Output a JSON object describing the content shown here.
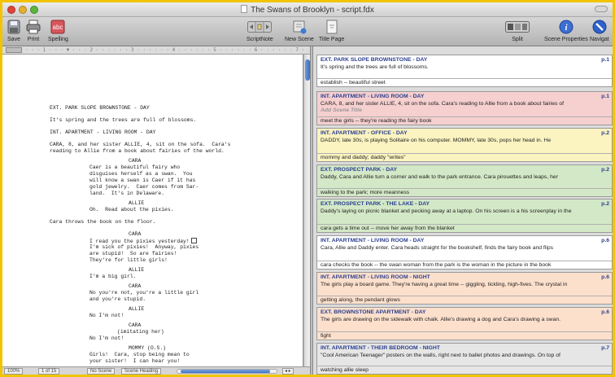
{
  "window": {
    "title": "The Swans of Brooklyn - script.fdx"
  },
  "toolbar": {
    "save": "Save",
    "print": "Print",
    "spelling": "Spelling",
    "scriptnote": "ScriptNote",
    "new_scene": "New Scene",
    "title_page": "Title Page",
    "split": "Split",
    "scene_properties": "Scene Properties",
    "navigator": "Navigat"
  },
  "statusbar": {
    "zoom": "100%",
    "page": "1 of 15",
    "scene_no": "No Scene",
    "element": "Scene Heading"
  },
  "script": {
    "lines": [
      {
        "k": "sh",
        "t": "EXT. PARK SLOPE BROWNSTONE - DAY"
      },
      {
        "k": "ac",
        "t": "It's spring and the trees are full of blossoms."
      },
      {
        "k": "sh",
        "t": "INT. APARTMENT - LIVING ROOM - DAY"
      },
      {
        "k": "ac",
        "t": "CARA, 8, and her sister ALLIE, 4, sit on the sofa.  Cara's"
      },
      {
        "k": "ac",
        "t": "reading to Allie from a book about fairies of the world."
      },
      {
        "k": "ch",
        "t": "CARA"
      },
      {
        "k": "dl",
        "t": "Caer is a beautiful fairy who"
      },
      {
        "k": "dl",
        "t": "disguises herself as a swan.  You"
      },
      {
        "k": "dl",
        "t": "will know a swan is Caer if it has"
      },
      {
        "k": "dl",
        "t": "gold jewelry.  Caer comes from Sar-"
      },
      {
        "k": "dl",
        "t": "land.  It's in Delaware."
      },
      {
        "k": "ch",
        "t": "ALLIE"
      },
      {
        "k": "dl",
        "t": "Oh.  Read about the pixies."
      },
      {
        "k": "ac",
        "t": "Cara throws the book on the floor."
      },
      {
        "k": "ch",
        "t": "CARA"
      },
      {
        "k": "dl",
        "t": "I read you the pixies yesterday!"
      },
      {
        "k": "dl",
        "t": "I'm sick of pixies!  Anyway, pixies"
      },
      {
        "k": "dl",
        "t": "are stupid!  So are fairies!"
      },
      {
        "k": "dl",
        "t": "They're for little girls!"
      },
      {
        "k": "ch",
        "t": "ALLIE"
      },
      {
        "k": "dl",
        "t": "I'm a big girl."
      },
      {
        "k": "ch",
        "t": "CARA"
      },
      {
        "k": "dl",
        "t": "No you're not, you're a little girl"
      },
      {
        "k": "dl",
        "t": "and you're stupid."
      },
      {
        "k": "ch",
        "t": "ALLIE"
      },
      {
        "k": "dl",
        "t": "No I'm not!"
      },
      {
        "k": "ch",
        "t": "CARA"
      },
      {
        "k": "pr",
        "t": "(imitating her)"
      },
      {
        "k": "dl",
        "t": "No I'm not!"
      },
      {
        "k": "ch",
        "t": "MOMMY (O.S.)"
      },
      {
        "k": "dl",
        "t": "Girls!  Cara, stop being mean to"
      },
      {
        "k": "dl",
        "t": "your sister!  I can hear you!"
      }
    ]
  },
  "scenes": [
    {
      "heading": "EXT. PARK SLOPE BROWNSTONE - DAY",
      "page": "p.1",
      "action": "It's spring and the trees are full of blossoms.",
      "placeholder": "",
      "summary": "establish -- beautiful street",
      "color": "#ffffff"
    },
    {
      "heading": "INT. APARTMENT - LIVING ROOM - DAY",
      "page": "p.1",
      "action": "CARA, 8, and her sister ALLIE, 4, sit on the sofa.  Cara's reading to Allie from a book about fairies of",
      "placeholder": "Add Scene Title",
      "summary": "meet the girls -- they're reading the fairy book",
      "color": "#f6cfcf"
    },
    {
      "heading": "INT. APARTMENT - OFFICE - DAY",
      "page": "p.2",
      "action": "DADDY, late 30s, is playing Solitaire on his computer.  MOMMY, late 30s, pops her head in.  He",
      "placeholder": "",
      "summary": "mommy and daddy; daddy \"writes\"",
      "color": "#fbf3c0"
    },
    {
      "heading": "EXT. PROSPECT PARK - DAY",
      "page": "p.2",
      "action": "Daddy, Cara and Allie turn a corner and walk to the park entrance.  Cara pirouettes and leaps, her",
      "placeholder": "",
      "summary": "walking to the park; more meanness",
      "color": "#d3e8c6"
    },
    {
      "heading": "EXT. PROSPECT PARK - THE LAKE - DAY",
      "page": "p.2",
      "action": "Daddy's laying on picnic blanket and pecking away at a laptop.  On his screen is a his screenplay in the",
      "placeholder": "",
      "summary": "cara gets a time out -- move her away from the blanket",
      "color": "#d3e8c6"
    },
    {
      "heading": "INT. APARTMENT - LIVING ROOM - DAY",
      "page": "p.6",
      "action": "Cara, Allie and Daddy enter.  Cara heads straight for the bookshelf, finds the fairy book and flips",
      "placeholder": "",
      "summary": "cara checks the book -- the swan woman from the park is the woman in the picture in the book",
      "color": "#ffffff"
    },
    {
      "heading": "INT. APARTMENT - LIVING ROOM - NIGHT",
      "page": "p.6",
      "action": "The girls play a board game.  They're having a great time -- giggling, tickling, high-fives.  The crystal in",
      "placeholder": "",
      "summary": "getting along, the pendant glows",
      "color": "#fde0cc"
    },
    {
      "heading": "EXT. BROWNSTONE APARTMENT - DAY",
      "page": "p.6",
      "action": "The girls are drawing on the sidewalk with chalk.  Allie's drawing a dog and Cara's drawing a swan.",
      "placeholder": "",
      "summary": "fight",
      "color": "#fde0cc"
    },
    {
      "heading": "INT. APARTMENT - THEIR BEDROOM - NIGHT",
      "page": "p.7",
      "action": "\"Cool American Teenager\" posters on the walls, right next to ballet photos and drawings.  On top of",
      "placeholder": "",
      "summary": "watching allie sleep",
      "color": "#e6e6e6"
    }
  ]
}
